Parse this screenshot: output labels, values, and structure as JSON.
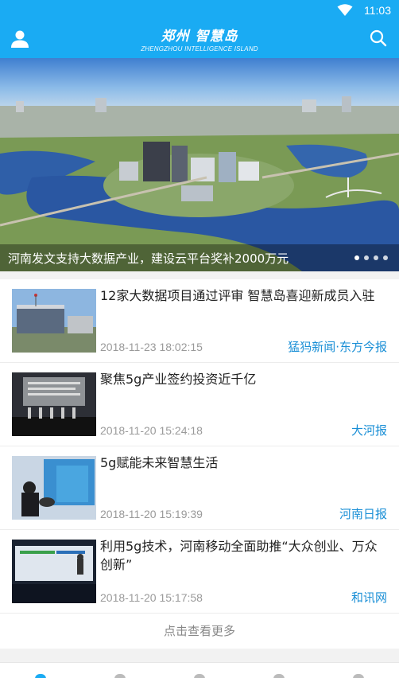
{
  "status_bar": {
    "time": "11:03",
    "wifi_icon": "wifi-icon"
  },
  "header": {
    "title": "郑州 智慧岛",
    "subtitle": "ZHENGZHOU INTELLIGENCE ISLAND",
    "user_icon": "user-icon",
    "search_icon": "search-icon",
    "color": "#1aabf3"
  },
  "banner": {
    "caption": "河南发文支持大数据产业，建设云平台奖补2000万元",
    "dots": 4,
    "active_dot": 0
  },
  "news": [
    {
      "title": "12家大数据项目通过评审 智慧岛喜迎新成员入驻",
      "time": "2018-11-23 18:02:15",
      "source": "猛犸新闻·东方今报"
    },
    {
      "title": "聚焦5g产业签约投资近千亿",
      "time": "2018-11-20 15:24:18",
      "source": "大河报"
    },
    {
      "title": "5g赋能未来智慧生活",
      "time": "2018-11-20 15:19:39",
      "source": "河南日报"
    },
    {
      "title": "利用5g技术，河南移动全面助推“大众创业、万众创新”",
      "time": "2018-11-20 15:17:58",
      "source": "和讯网"
    }
  ],
  "load_more": "点击查看更多",
  "colors": {
    "accent": "#1aabf3",
    "source_text": "#1a8fd6",
    "meta_text": "#9a9a9a"
  }
}
